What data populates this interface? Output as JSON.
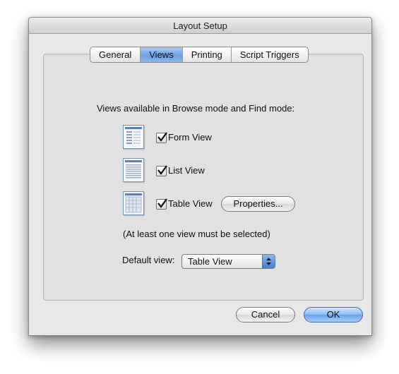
{
  "window": {
    "title": "Layout Setup"
  },
  "tabs": [
    {
      "label": "General",
      "active": false
    },
    {
      "label": "Views",
      "active": true
    },
    {
      "label": "Printing",
      "active": false
    },
    {
      "label": "Script Triggers",
      "active": false
    }
  ],
  "views": {
    "heading": "Views available in Browse mode and Find mode:",
    "items": [
      {
        "label": "Form View",
        "checked": true,
        "icon": "form-view-icon"
      },
      {
        "label": "List View",
        "checked": true,
        "icon": "list-view-icon"
      },
      {
        "label": "Table View",
        "checked": true,
        "icon": "table-view-icon"
      }
    ],
    "properties_button": "Properties...",
    "note": "(At least one view must be selected)"
  },
  "default_view": {
    "label": "Default view:",
    "value": "Table View"
  },
  "buttons": {
    "cancel": "Cancel",
    "ok": "OK"
  },
  "colors": {
    "accent": "#6c9fe1",
    "window_bg": "#e8e8e8"
  }
}
